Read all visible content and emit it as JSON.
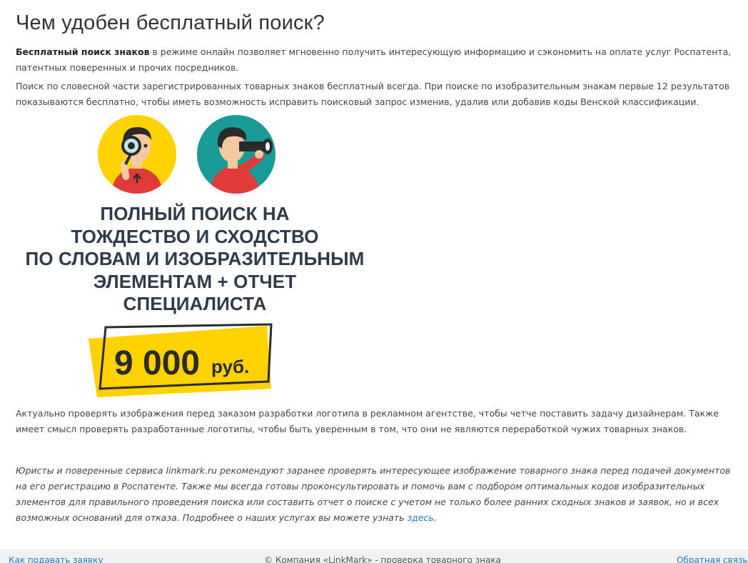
{
  "page": {
    "title": "Чем удобен бесплатный поиск?"
  },
  "intro": {
    "bold_lead": "Бесплатный поиск знаков",
    "rest": " в режиме онлайн позволяет мгновенно получить интересующую информацию и сэкономить на оплате услуг Роспатента, патентных поверенных и прочих посредников."
  },
  "paragraph2": "Поиск по словесной части зарегистрированных товарных знаков бесплатный всегда. При поиске по изобразительным знакам первые 12 результатов показываются бесплатно, чтобы иметь возможность исправить поисковый запрос изменив, удалив или добавив коды Венской классификации.",
  "promo": {
    "headline_lines": [
      "ПОЛНЫЙ ПОИСК НА",
      "ТОЖДЕСТВО И СХОДСТВО",
      "ПО СЛОВАМ И ИЗОБРАЗИТЕЛЬНЫМ",
      "ЭЛЕМЕНТАМ + ОТЧЕТ",
      "СПЕЦИАЛИСТА"
    ],
    "price": "9 000",
    "currency": "руб.",
    "colors": {
      "yellow": "#ffd200",
      "teal": "#1a9b97",
      "red": "#e03a3a",
      "dark": "#2f3b48"
    },
    "icons": [
      "magnifier-person-icon",
      "binoculars-person-icon"
    ]
  },
  "paragraph3": "Актуально проверять изображения перед заказом разработки логотипа в рекламном агентстве, чтобы четче поставить задачу дизайнерам. Также имеет смысл проверять разработанные логотипы, чтобы быть уверенным в том, что они не являются переработкой чужих товарных знаков.",
  "note": {
    "text": "Юристы и поверенные сервиса linkmark.ru рекомендуют заранее проверять интересующее изображение товарного знака перед подачей документов на его регистрацию в Роспатенте. Также мы всегда готовы проконсультировать и помочь вам с подбором оптимальных кодов изобразительных элементов для правильного проведения поиска или составить отчет о поиске с учетом не только более ранних сходных знаков и заявок, но и всех возможных оснований для отказа. Подробнее о наших услугах вы можете узнать ",
    "link": "здесь",
    "end": "."
  },
  "footer": {
    "left_link": "Как подавать заявку",
    "copyright": "© Компания «LinkMark» - проверка товарного знака",
    "right_link": "Обратная связь"
  }
}
